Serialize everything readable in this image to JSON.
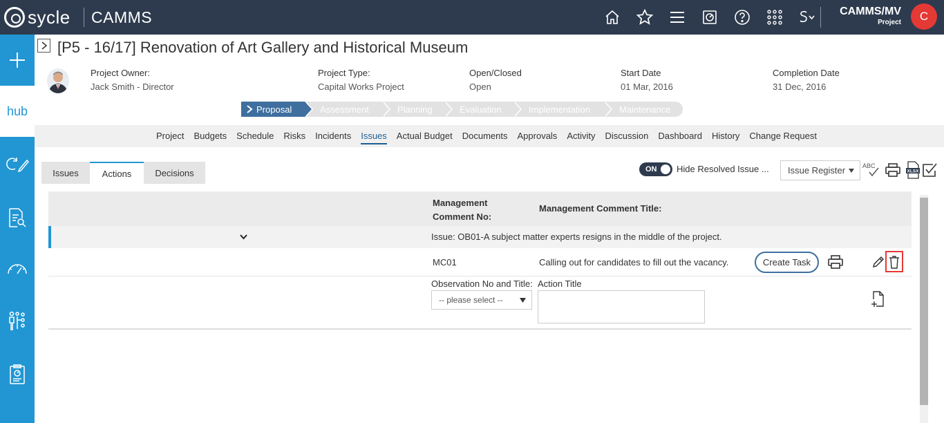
{
  "topbar": {
    "logo_text": "sycle",
    "app_name": "CAMMS",
    "user_name": "CAMMS/MV",
    "user_role": "Project",
    "avatar_letter": "C",
    "icons": [
      "home-icon",
      "star-icon",
      "menu-icon",
      "dashboard-icon",
      "help-icon",
      "apps-grid-icon",
      "switch-icon"
    ]
  },
  "sidebar": {
    "hub_label": "hub",
    "icons": [
      "add-icon",
      "hub-icon",
      "edit-cycle-icon",
      "report-search-icon",
      "gauge-icon",
      "org-structure-icon",
      "clipboard-icon"
    ]
  },
  "project": {
    "title": "[P5 - 16/17] Renovation of Art Gallery and Historical Museum",
    "owner_label": "Project Owner:",
    "owner_value": "Jack Smith - Director",
    "type_label": "Project Type:",
    "type_value": "Capital Works Project",
    "status_label": "Open/Closed",
    "status_value": "Open",
    "start_label": "Start Date",
    "start_value": "01 Mar, 2016",
    "completion_label": "Completion Date",
    "completion_value": "31 Dec, 2016"
  },
  "stages": [
    "Proposal",
    "Assessment",
    "Planning",
    "Evaluation",
    "Implementation",
    "Maintenance"
  ],
  "nav_tabs": [
    "Project",
    "Budgets",
    "Schedule",
    "Risks",
    "Incidents",
    "Issues",
    "Actual Budget",
    "Documents",
    "Approvals",
    "Activity",
    "Discussion",
    "Dashboard",
    "History",
    "Change Request"
  ],
  "sub_tabs": [
    "Issues",
    "Actions",
    "Decisions"
  ],
  "toolbar": {
    "toggle_label": "ON",
    "hide_resolved_label": "Hide Resolved Issue ...",
    "register_select": "Issue Register",
    "spellcheck_label": "ABC",
    "xlsx_label": "XLSX"
  },
  "grid": {
    "col_comment_no": "Management Comment No:",
    "col_comment_title": "Management Comment Title:",
    "group_label": "Issue: OB01-A subject matter experts resigns in the middle of the project.",
    "row": {
      "comment_no": "MC01",
      "comment_title": "Calling out for candidates to fill out the vacancy.",
      "create_task_label": "Create Task"
    },
    "new_row": {
      "observation_label": "Observation No and Title:",
      "observation_placeholder": "-- please select --",
      "action_title_label": "Action Title"
    }
  }
}
